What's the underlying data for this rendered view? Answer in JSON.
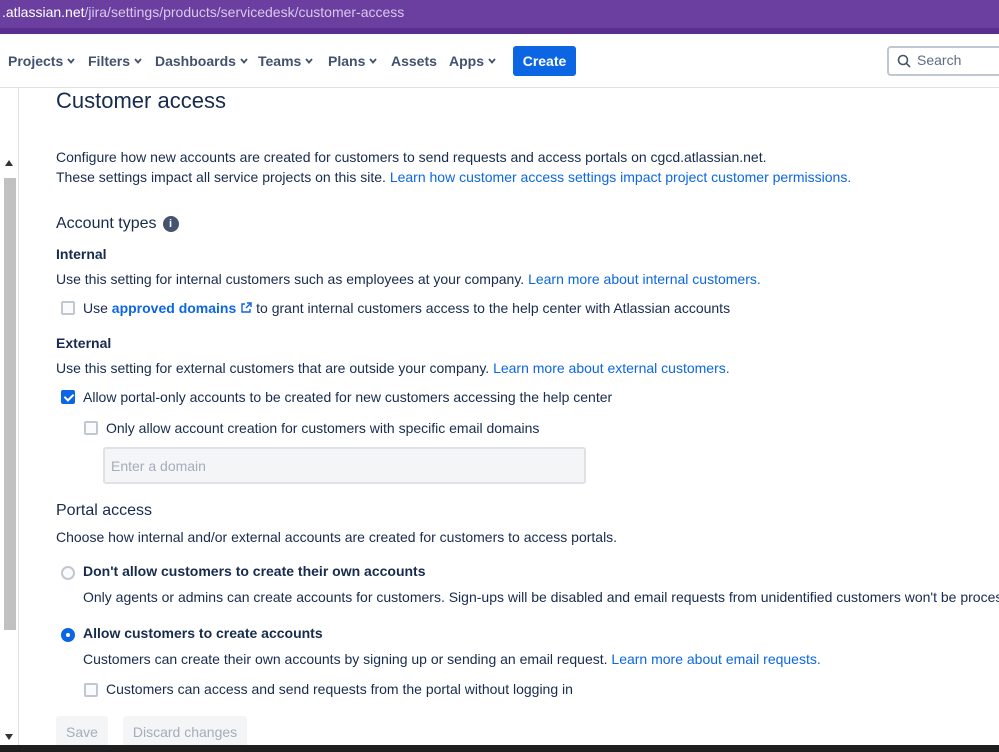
{
  "browser": {
    "url_host": ".atlassian.net",
    "url_path": "/jira/settings/products/servicedesk/customer-access"
  },
  "nav": {
    "items": [
      {
        "label": "Projects",
        "has_menu": true
      },
      {
        "label": "Filters",
        "has_menu": true
      },
      {
        "label": "Dashboards",
        "has_menu": true
      },
      {
        "label": "Teams",
        "has_menu": true
      },
      {
        "label": "Plans",
        "has_menu": true
      },
      {
        "label": "Assets",
        "has_menu": false
      },
      {
        "label": "Apps",
        "has_menu": true
      }
    ],
    "create_label": "Create",
    "search_placeholder": "Search"
  },
  "page": {
    "title": "Customer access",
    "intro_line1": "Configure how new accounts are created for customers to send requests and access portals on cgcd.atlassian.net.",
    "intro_line2_text": "These settings impact all service projects on this site.",
    "intro_line2_link": "Learn how customer access settings impact project customer permissions."
  },
  "account_types": {
    "heading": "Account types",
    "internal": {
      "heading": "Internal",
      "desc": "Use this setting for internal customers such as employees at your company.",
      "link": "Learn more about internal customers.",
      "option_prefix": "Use",
      "option_link": "approved domains",
      "option_suffix": "to grant internal customers access to the help center with Atlassian accounts",
      "option_checked": false
    },
    "external": {
      "heading": "External",
      "desc": "Use this setting for external customers that are outside your company.",
      "link": "Learn more about external customers.",
      "option_allow": "Allow portal-only accounts to be created for new customers accessing the help center",
      "option_allow_checked": true,
      "option_domains": "Only allow account creation for customers with specific email domains",
      "option_domains_checked": false,
      "domain_placeholder": "Enter a domain"
    }
  },
  "portal_access": {
    "heading": "Portal access",
    "desc": "Choose how internal and/or external accounts are created for customers to access portals.",
    "option1_title": "Don't allow customers to create their own accounts",
    "option1_desc": "Only agents or admins can create accounts for customers. Sign-ups will be disabled and email requests from unidentified customers won't be processed.",
    "option1_selected": false,
    "option2_title": "Allow customers to create accounts",
    "option2_desc": "Customers can create their own accounts by signing up or sending an email request.",
    "option2_link": "Learn more about email requests.",
    "option2_selected": true,
    "anon_option": "Customers can access and send requests from the portal without logging in",
    "anon_checked": false
  },
  "actions": {
    "save": "Save",
    "discard": "Discard changes"
  },
  "colors": {
    "accent": "#0c66e4",
    "browser_bar": "#6b3fa0"
  }
}
